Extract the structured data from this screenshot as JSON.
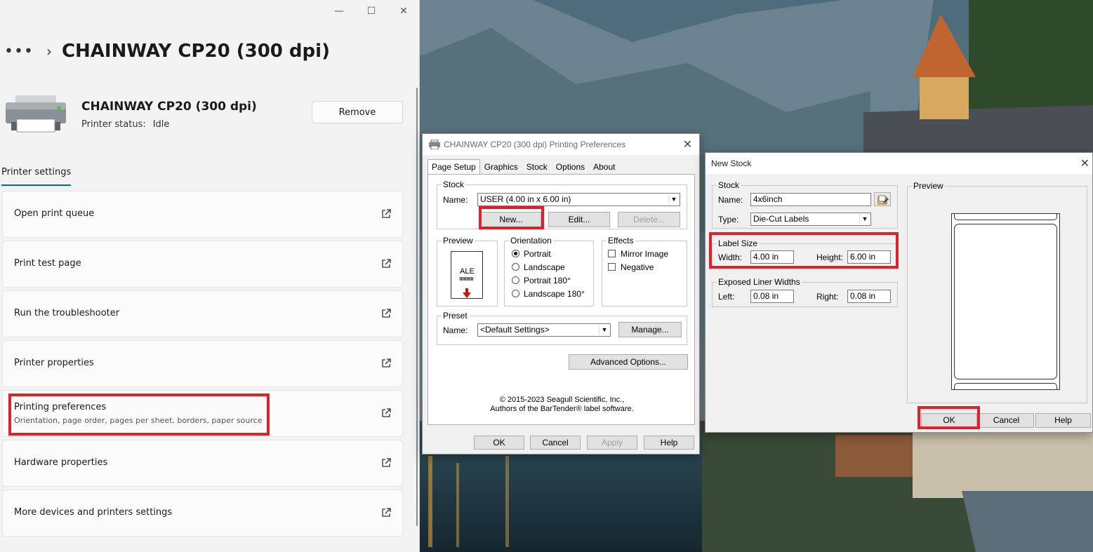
{
  "settings": {
    "breadcrumb_more": "•••",
    "breadcrumb_sep": "›",
    "page_title": "CHAINWAY CP20 (300 dpi)",
    "printer_name": "CHAINWAY CP20 (300 dpi)",
    "status_label": "Printer status:",
    "status_value": "Idle",
    "remove_label": "Remove",
    "section_tab": "Printer settings",
    "items": [
      {
        "label": "Open print queue",
        "sub": ""
      },
      {
        "label": "Print test page",
        "sub": ""
      },
      {
        "label": "Run the troubleshooter",
        "sub": ""
      },
      {
        "label": "Printer properties",
        "sub": ""
      },
      {
        "label": "Printing preferences",
        "sub": "Orientation, page order, pages per sheet, borders, paper source"
      },
      {
        "label": "Hardware properties",
        "sub": ""
      },
      {
        "label": "More devices and printers settings",
        "sub": ""
      }
    ]
  },
  "prefs": {
    "title": "CHAINWAY CP20 (300 dpi) Printing Preferences",
    "tabs": [
      "Page Setup",
      "Graphics",
      "Stock",
      "Options",
      "About"
    ],
    "stock_caption": "Stock",
    "name_label": "Name:",
    "stock_name": "USER (4.00 in x 6.00 in)",
    "new_label": "New...",
    "edit_label": "Edit...",
    "delete_label": "Delete...",
    "preview_caption": "Preview",
    "preview_text": "ALE",
    "orientation_caption": "Orientation",
    "orientations": [
      "Portrait",
      "Landscape",
      "Portrait 180°",
      "Landscape 180°"
    ],
    "effects_caption": "Effects",
    "effects": [
      "Mirror Image",
      "Negative"
    ],
    "preset_caption": "Preset",
    "preset_name_label": "Name:",
    "preset_value": "<Default Settings>",
    "manage_label": "Manage...",
    "advanced_label": "Advanced Options...",
    "copyright_1": "© 2015-2023 Seagull Scientific, Inc.,",
    "copyright_2": "Authors of the BarTender® label software.",
    "ok": "OK",
    "cancel": "Cancel",
    "apply": "Apply",
    "help": "Help"
  },
  "newstock": {
    "title": "New Stock",
    "stock_caption": "Stock",
    "name_label": "Name:",
    "name_value": "4x6inch",
    "type_label": "Type:",
    "type_value": "Die-Cut Labels",
    "label_size_caption": "Label Size",
    "width_label": "Width:",
    "width_value": "4.00 in",
    "height_label": "Height:",
    "height_value": "6.00 in",
    "liner_caption": "Exposed Liner Widths",
    "left_label": "Left:",
    "left_value": "0.08 in",
    "right_label": "Right:",
    "right_value": "0.08 in",
    "preview_caption": "Preview",
    "ok": "OK",
    "cancel": "Cancel",
    "help": "Help"
  },
  "colors": {
    "highlight": "#e0202a",
    "accent": "#0067c0"
  }
}
